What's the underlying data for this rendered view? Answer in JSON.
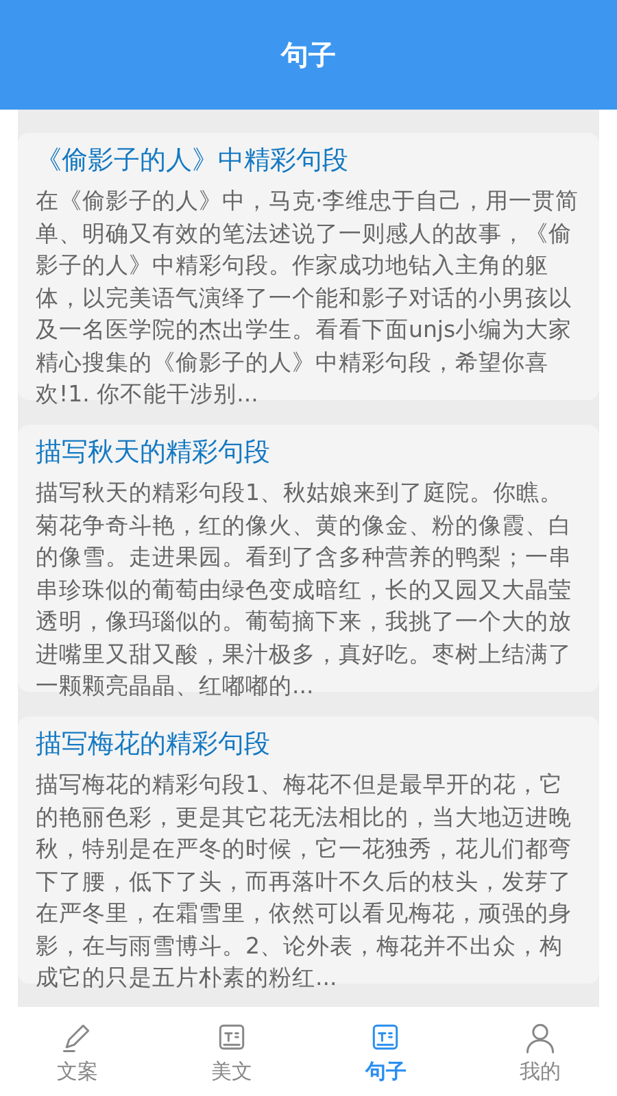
{
  "header": {
    "title": "句子"
  },
  "articles": [
    {
      "title": "《偷影子的人》中精彩句段",
      "summary": "在《偷影子的人》中，马克·李维忠于自己，用一贯简单、明确又有效的笔法述说了一则感人的故事，《偷影子的人》中精彩句段。作家成功地钻入主角的躯体，以完美语气演绎了一个能和影子对话的小男孩以及一名医学院的杰出学生。看看下面unjs小编为大家精心搜集的《偷影子的人》中精彩句段，希望你喜欢!1. 你不能干涉别..."
    },
    {
      "title": "描写秋天的精彩句段",
      "summary": "描写秋天的精彩句段1、秋姑娘来到了庭院。你瞧。菊花争奇斗艳，红的像火、黄的像金、粉的像霞、白的像雪。走进果园。看到了含多种营养的鸭梨；一串串珍珠似的葡萄由绿色变成暗红，长的又园又大晶莹透明，像玛瑙似的。葡萄摘下来，我挑了一个大的放进嘴里又甜又酸，果汁极多，真好吃。枣树上结满了一颗颗亮晶晶、红嘟嘟的..."
    },
    {
      "title": "描写梅花的精彩句段",
      "summary": "描写梅花的精彩句段1、梅花不但是最早开的花，它的艳丽色彩，更是其它花无法相比的，当大地迈进晚秋，特别是在严冬的时候，它一花独秀，花儿们都弯下了腰，低下了头，而再落叶不久后的枝头，发芽了在严冬里，在霜雪里，依然可以看见梅花，顽强的身影，在与雨雪博斗。2、论外表，梅花并不出众，构成它的只是五片朴素的粉红..."
    }
  ],
  "tab_bar": [
    {
      "kind": "pencil",
      "label": "文案",
      "selected": false
    },
    {
      "kind": "text",
      "label": "美文",
      "selected": false
    },
    {
      "kind": "text",
      "label": "句子",
      "selected": true
    },
    {
      "kind": "person",
      "label": "我的",
      "selected": false
    }
  ]
}
